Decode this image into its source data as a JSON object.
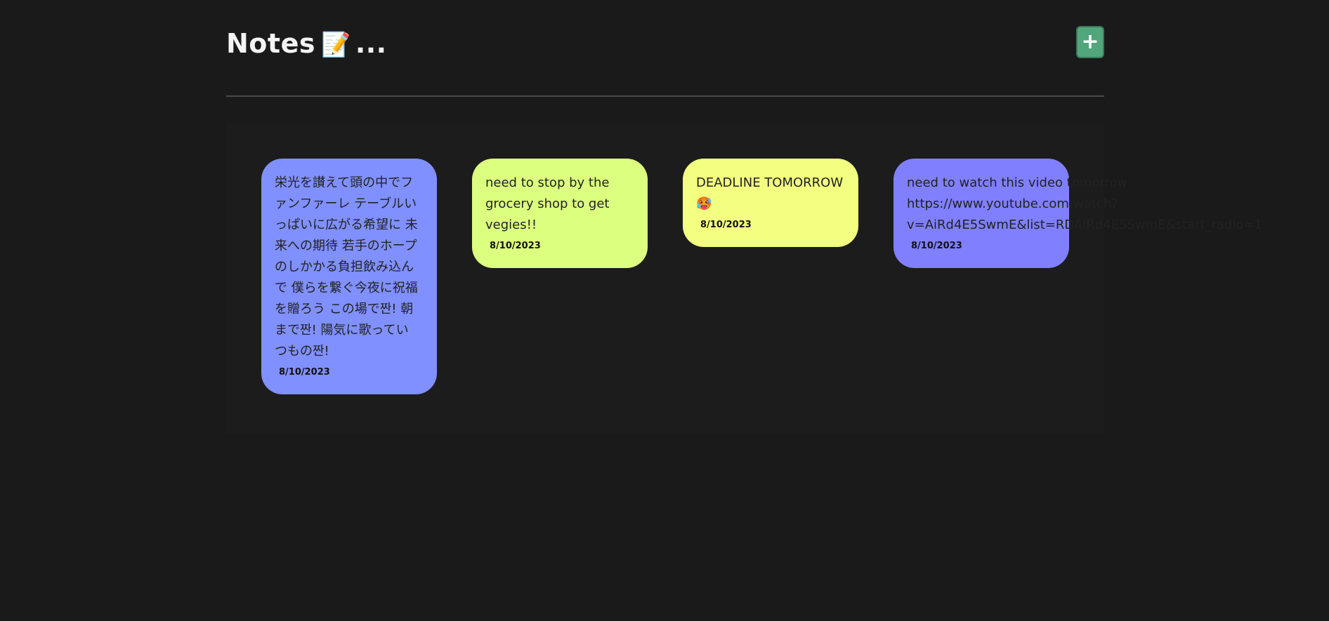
{
  "header": {
    "title": "Notes",
    "title_emoji": "📝",
    "title_suffix": "...",
    "add_label": "+"
  },
  "colors": {
    "background": "#1a1a1a",
    "add_button": "#52a67b",
    "divider": "#4a4a4a"
  },
  "notes": [
    {
      "lines": [
        "栄光を讃えて頭の中でフ",
        "ァンファーレ テーブルい",
        "っぱいに広がる希望に 未",
        "来への期待 若手のホープ",
        "のしかかる負担飲み込ん",
        "で 僕らを繋ぐ今夜に祝福",
        "を贈ろう この場で짠! 朝",
        "まで짠! 陽気に歌ってい",
        "つもの짠!"
      ],
      "date": "8/10/2023",
      "color": "#8090ff"
    },
    {
      "lines": [
        "need to stop by the",
        "grocery shop to get",
        "vegies!!"
      ],
      "date": "8/10/2023",
      "color": "#dcff7f"
    },
    {
      "lines": [
        "DEADLINE TOMORROW",
        "🥵"
      ],
      "date": "8/10/2023",
      "color": "#f2ff80"
    },
    {
      "lines": [
        "need to watch this video tomorrow",
        "https://www.youtube.com/watch?",
        "v=AiRd4E5SwmE&list=RDAiRd4E5SwmE&start_radio=1"
      ],
      "date": "8/10/2023",
      "color": "#8080ff"
    }
  ]
}
